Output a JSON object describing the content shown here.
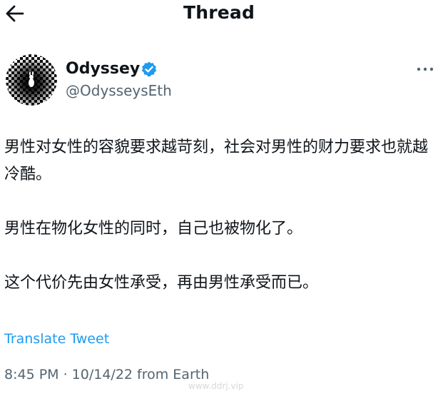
{
  "header": {
    "back_icon": "arrow-left-icon",
    "title": "Thread"
  },
  "author": {
    "display_name": "Odyssey",
    "verified_icon": "verified-badge-icon",
    "verified_color": "#1d9bf0",
    "handle": "@OdysseysEth",
    "more_icon": "more-horizontal-icon"
  },
  "tweet": {
    "paragraphs": [
      "男性对女性的容貌要求越苛刻，社会对男性的财力要求也就越冷酷。",
      "男性在物化女性的同时，自己也被物化了。",
      "这个代价先由女性承受，再由男性承受而已。"
    ],
    "translate_label": "Translate Tweet",
    "translate_color": "#1d9bf0",
    "timestamp": "8:45 PM · 10/14/22 from Earth"
  },
  "watermark": "www.ddrj.vip"
}
